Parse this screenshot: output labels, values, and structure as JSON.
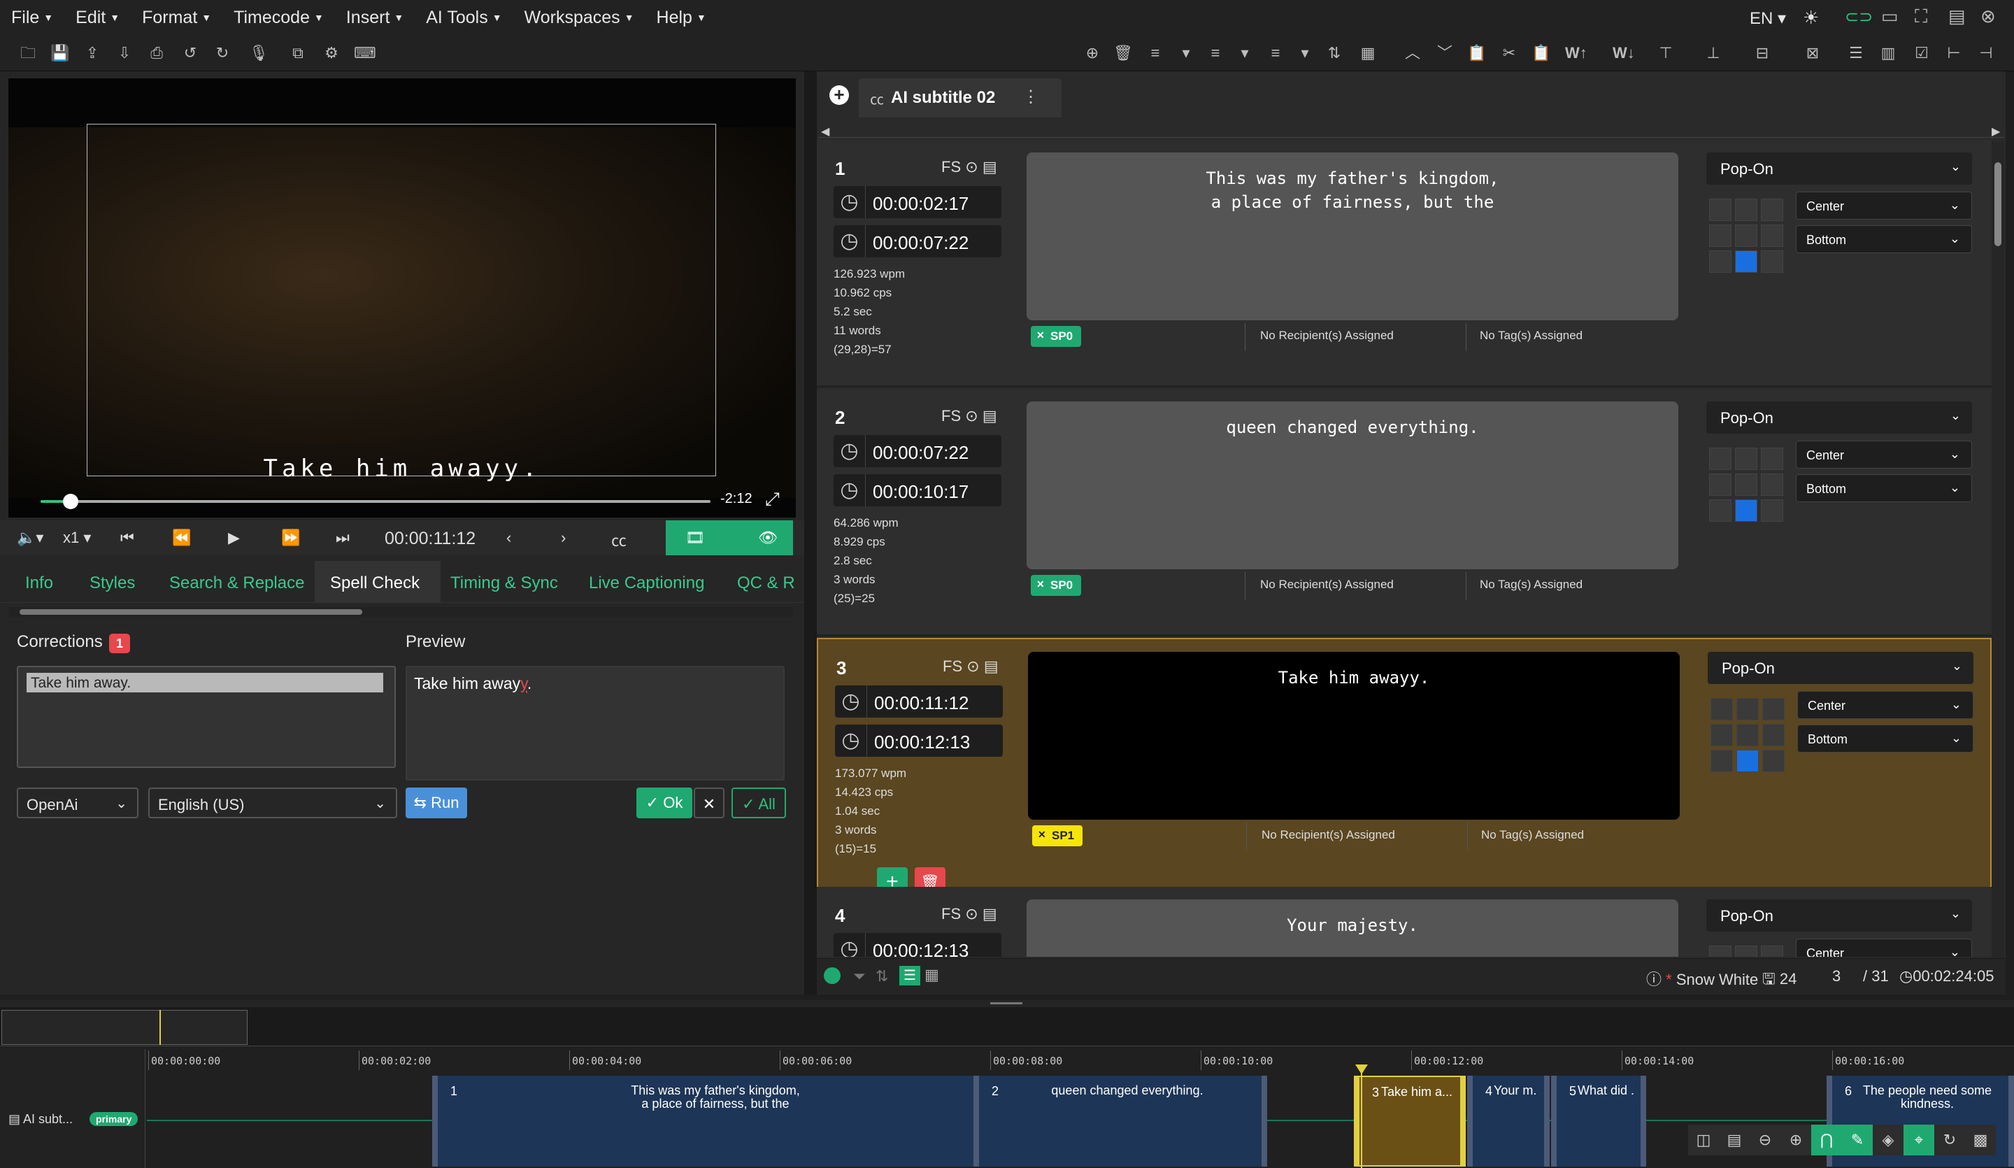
{
  "menu": [
    "File",
    "Edit",
    "Format",
    "Timecode",
    "Insert",
    "AI Tools",
    "Workspaces",
    "Help"
  ],
  "menu_right": {
    "lang": "EN"
  },
  "video": {
    "subtitle": "Take him awayy.",
    "remaining": "-2:12",
    "progress_fraction": 0.045
  },
  "controls": {
    "speed": "x1",
    "timecode": "00:00:11:12"
  },
  "tabs": [
    "Info",
    "Styles",
    "Search & Replace",
    "Spell Check",
    "Timing & Sync",
    "Live Captioning",
    "QC & R"
  ],
  "spellcheck": {
    "corrections_label": "Corrections",
    "corrections_count": "1",
    "preview_label": "Preview",
    "correction_text": "Take him away.",
    "preview_text_main": "Take him away",
    "preview_text_err": "y",
    "preview_text_end": ".",
    "engine": "OpenAi",
    "language": "English (US)",
    "run_label": "Run",
    "ok_label": "Ok",
    "all_label": "All"
  },
  "doc": {
    "tab_label": "AI subtitle 02"
  },
  "cards": [
    {
      "num": "1",
      "fs": "FS",
      "tc_in": "00:00:02:17",
      "tc_out": "00:00:07:22",
      "stats": [
        "126.923 wpm",
        "10.962 cps",
        "5.2 sec",
        "11 words",
        "(29,28)=57"
      ],
      "text": "This was my father's kingdom,\na place of fairness, but the",
      "speaker": "SP0",
      "recipients": "No Recipient(s) Assigned",
      "tags": "No Tag(s) Assigned",
      "mode": "Pop-On",
      "halign": "Center",
      "valign": "Bottom"
    },
    {
      "num": "2",
      "fs": "FS",
      "tc_in": "00:00:07:22",
      "tc_out": "00:00:10:17",
      "stats": [
        "64.286 wpm",
        "8.929 cps",
        "2.8 sec",
        "3 words",
        "(25)=25"
      ],
      "text": "queen changed everything.",
      "speaker": "SP0",
      "recipients": "No Recipient(s) Assigned",
      "tags": "No Tag(s) Assigned",
      "mode": "Pop-On",
      "halign": "Center",
      "valign": "Bottom"
    },
    {
      "num": "3",
      "fs": "FS",
      "tc_in": "00:00:11:12",
      "tc_out": "00:00:12:13",
      "stats": [
        "173.077 wpm",
        "14.423 cps",
        "1.04 sec",
        "3 words",
        "(15)=15"
      ],
      "text": "Take him awayy.",
      "speaker": "SP1",
      "recipients": "No Recipient(s) Assigned",
      "tags": "No Tag(s) Assigned",
      "mode": "Pop-On",
      "halign": "Center",
      "valign": "Bottom"
    },
    {
      "num": "4",
      "fs": "FS",
      "tc_in": "00:00:12:13",
      "tc_out": "",
      "stats": [],
      "text": "Your majesty.",
      "speaker": "",
      "recipients": "",
      "tags": "",
      "mode": "Pop-On",
      "halign": "Center",
      "valign": ""
    }
  ],
  "status": {
    "title": "Snow White",
    "count": "24",
    "current": "3",
    "total": "/ 31",
    "duration": "00:02:24:05"
  },
  "timeline": {
    "marks": [
      "00:00:00:00",
      "00:00:02:00",
      "00:00:04:00",
      "00:00:06:00",
      "00:00:08:00",
      "00:00:10:00",
      "00:00:12:00",
      "00:00:14:00",
      "00:00:16:00"
    ],
    "track_name": "AI subt...",
    "track_badge": "primary",
    "segments": [
      {
        "n": "1",
        "t": "This was my father's kingdom,\na place of fairness, but the"
      },
      {
        "n": "2",
        "t": "queen changed everything."
      },
      {
        "n": "3",
        "t": "Take him a..."
      },
      {
        "n": "4",
        "t": "Your m..."
      },
      {
        "n": "5",
        "t": "What did ..."
      },
      {
        "n": "6",
        "t": "The people need some\nkindness."
      }
    ]
  },
  "colors": {
    "accent": "#1fa971",
    "selected_card": "#5a4620",
    "speaker0": "#1fa971",
    "speaker1": "#f5e50a",
    "delete": "#e5484d",
    "run": "#4a90d9"
  }
}
